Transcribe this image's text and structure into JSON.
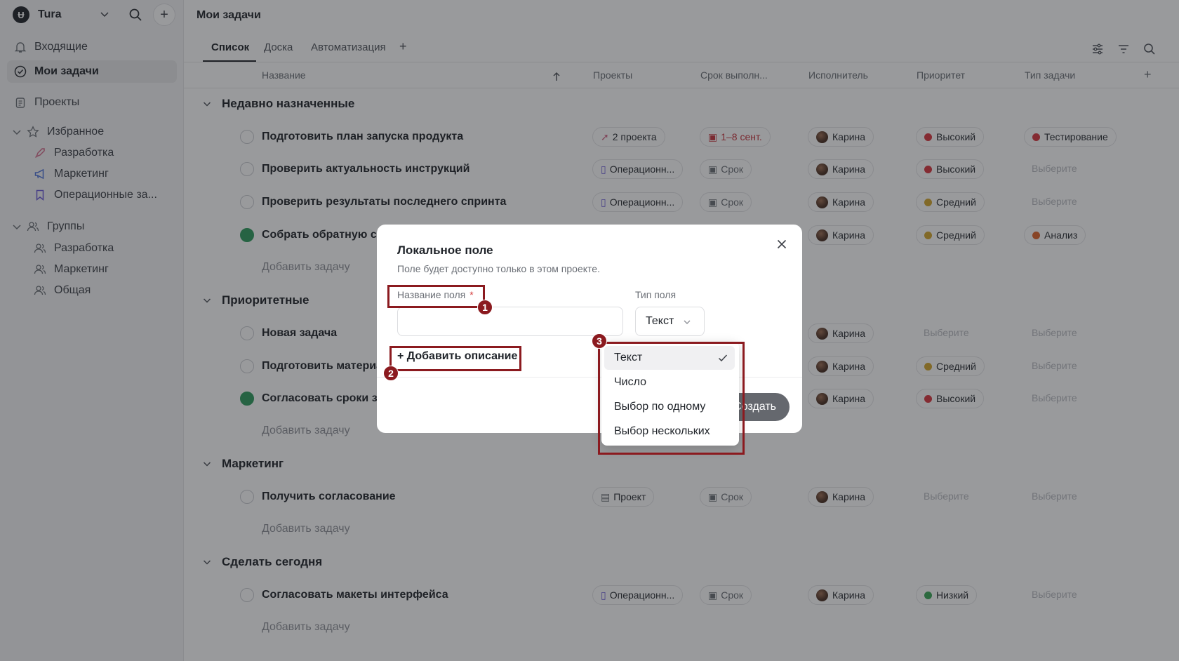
{
  "workspace": {
    "logo_letter": "Ʉ",
    "name": "Tura"
  },
  "sidebar": {
    "inbox": "Входящие",
    "my_tasks": "Мои задачи",
    "projects": "Проекты",
    "favorites": {
      "label": "Избранное",
      "items": [
        "Разработка",
        "Маркетинг",
        "Операционные за..."
      ]
    },
    "groups": {
      "label": "Группы",
      "items": [
        "Разработка",
        "Маркетинг",
        "Общая"
      ]
    }
  },
  "page_title": "Мои задачи",
  "tabs": [
    "Список",
    "Доска",
    "Автоматизация"
  ],
  "tab_add": "+",
  "columns": {
    "name": "Название",
    "projects": "Проекты",
    "due": "Срок выполн...",
    "assignee": "Исполнитель",
    "priority": "Приоритет",
    "type": "Тип задачи",
    "add": "+"
  },
  "colors": {
    "high": "#d9363e",
    "medium": "#d4a72c",
    "low": "#3aa757",
    "testing": "#d9363e",
    "analysis": "#e0642a",
    "accent_highlight": "#8b1a1f",
    "done": "#2e9b5e"
  },
  "groups": [
    {
      "title": "Недавно назначенные",
      "add_task": "Добавить задачу",
      "rows": [
        {
          "name": "Подготовить план запуска продукта",
          "project": "2 проекта",
          "due": "1–8 сент.",
          "assignee": "Карина",
          "priority": "Высокий",
          "type": "Тестирование"
        },
        {
          "name": "Проверить актуальность инструкций",
          "project": "Операционн...",
          "due": "Срок",
          "assignee": "Карина",
          "priority": "Высокий",
          "type": "Выберите"
        },
        {
          "name": "Проверить результаты последнего спринта",
          "project": "Операционн...",
          "due": "Срок",
          "assignee": "Карина",
          "priority": "Средний",
          "type": "Выберите"
        },
        {
          "name": "Собрать обратную св",
          "assignee": "Карина",
          "priority": "Средний",
          "type": "Анализ"
        }
      ]
    },
    {
      "title": "Приоритетные",
      "add_task": "Добавить задачу",
      "rows": [
        {
          "name": "Новая задача",
          "assignee": "Карина",
          "priority": "Выберите",
          "type": "Выберите"
        },
        {
          "name": "Подготовить материа",
          "assignee": "Карина",
          "priority": "Средний",
          "type": "Выберите"
        },
        {
          "name": "Согласовать сроки за",
          "assignee": "Карина",
          "priority": "Высокий",
          "type": "Выберите"
        }
      ]
    },
    {
      "title": "Маркетинг",
      "add_task": "Добавить задачу",
      "rows": [
        {
          "name": "Получить согласование",
          "project": "Проект",
          "due": "Срок",
          "assignee": "Карина",
          "priority": "Выберите",
          "type": "Выберите"
        }
      ]
    },
    {
      "title": "Сделать сегодня",
      "add_task": "Добавить задачу",
      "rows": [
        {
          "name": "Согласовать макеты интерфейса",
          "project": "Операционн...",
          "due": "Срок",
          "assignee": "Карина",
          "priority": "Низкий",
          "type": "Выберите"
        }
      ]
    }
  ],
  "modal": {
    "title": "Локальное поле",
    "subtitle": "Поле будет доступно только в этом проекте.",
    "field_name_label": "Название поля",
    "required_mark": "*",
    "field_type_label": "Тип поля",
    "field_type_value": "Текст",
    "add_description": "+ Добавить описание",
    "create_button": "Создать"
  },
  "type_dropdown": [
    "Текст",
    "Число",
    "Выбор по одному",
    "Выбор нескольких"
  ],
  "annotations": [
    "1",
    "2",
    "3"
  ]
}
